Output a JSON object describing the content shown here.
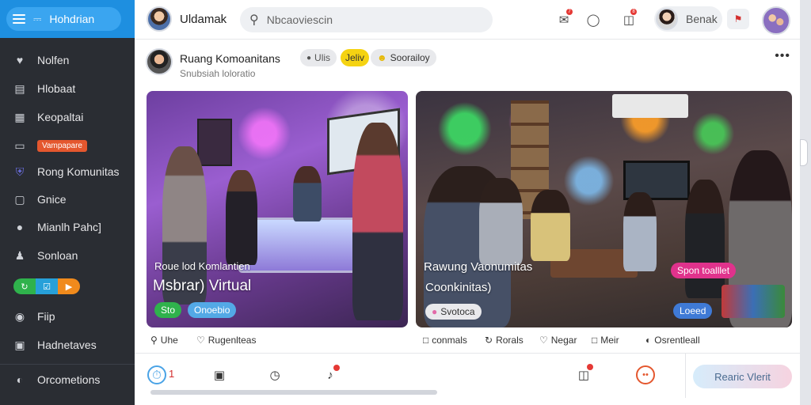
{
  "sidebar": {
    "home_label": "Hohdrian",
    "items": [
      {
        "label": "Nolfen",
        "icon": "heart-icon"
      },
      {
        "label": "Hlobaat",
        "icon": "document-icon"
      },
      {
        "label": "Keopaltai",
        "icon": "grid-icon"
      },
      {
        "label": "Vampapare",
        "icon": "folder-icon"
      },
      {
        "label": "Rong Komunitas",
        "icon": "shield-icon"
      },
      {
        "label": "Gnice",
        "icon": "square-icon"
      },
      {
        "label": "Mianlh Pahc]",
        "icon": "user-icon"
      },
      {
        "label": "Sonloan",
        "icon": "person-icon"
      },
      {
        "label": "Fiip",
        "icon": "location-pin-icon"
      },
      {
        "label": "Hadnetaves",
        "icon": "camera-icon"
      }
    ],
    "pill_icons": [
      "refresh-icon",
      "check-card-icon",
      "play-icon"
    ],
    "footer_label": "Orcometions"
  },
  "topbar": {
    "title": "Uldamak",
    "search_placeholder": "Nbcaoviescin",
    "user_name": "Benak",
    "notify_count": "7",
    "badge_count": "8"
  },
  "post": {
    "title": "Ruang Komoanitans",
    "subtitle": "Snubsiah loloratio",
    "tags": [
      "Ulis",
      "Jeliv",
      "Soorailoy"
    ]
  },
  "cards": [
    {
      "caption_small": "Roue lod Komlantien",
      "caption_big": "Msbrar) Virtual",
      "chips": [
        "Sto",
        "Onoebio"
      ]
    },
    {
      "caption_small": "Rawung Vaonumitas",
      "caption_big": "Coonkinitas)",
      "chips": [
        "Svotoca",
        "Spon toalllet",
        "Loeed"
      ]
    }
  ],
  "actions": [
    {
      "label": "Uhe",
      "icon": "location-icon"
    },
    {
      "label": "Rugenlteas",
      "icon": "like-icon"
    },
    {
      "label": "conmals",
      "icon": "comment-icon"
    },
    {
      "label": "Rorals",
      "icon": "refresh-icon"
    },
    {
      "label": "Negar",
      "icon": "heart-icon"
    },
    {
      "label": "Meir",
      "icon": "chat-icon"
    },
    {
      "label": "Osrentleall",
      "icon": "share-icon"
    }
  ],
  "bottombar": {
    "counter": "1",
    "react_label": "Rearic Vlerit"
  },
  "colors": {
    "accent": "#1e8fe0",
    "sidebar_bg": "#2a2d33",
    "danger": "#e53935",
    "tag_yellow": "#f5d312"
  }
}
